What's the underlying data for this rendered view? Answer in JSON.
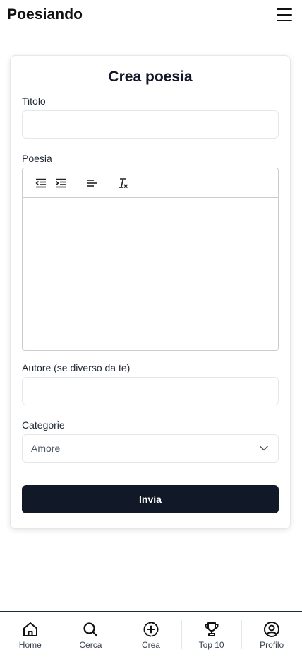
{
  "header": {
    "brand": "Poesiando",
    "menu_icon": "hamburger-menu-icon"
  },
  "form": {
    "title": "Crea poesia",
    "title_label": "Titolo",
    "title_value": "",
    "poem_label": "Poesia",
    "toolbar": {
      "items": [
        "outdent-icon",
        "indent-icon",
        "align-left-icon",
        "clear-format-icon"
      ]
    },
    "author_label": "Autore (se diverso da te)",
    "author_value": "",
    "category_label": "Categorie",
    "category_selected": "Amore",
    "submit_label": "Invia"
  },
  "nav": {
    "items": [
      {
        "label": "Home",
        "icon": "home-icon"
      },
      {
        "label": "Cerca",
        "icon": "search-icon"
      },
      {
        "label": "Crea",
        "icon": "plus-circle-icon"
      },
      {
        "label": "Top 10",
        "icon": "trophy-icon"
      },
      {
        "label": "Profilo",
        "icon": "user-circle-icon"
      }
    ]
  },
  "colors": {
    "primary": "#111827",
    "border": "#e5e7eb",
    "text": "#1f2937"
  }
}
